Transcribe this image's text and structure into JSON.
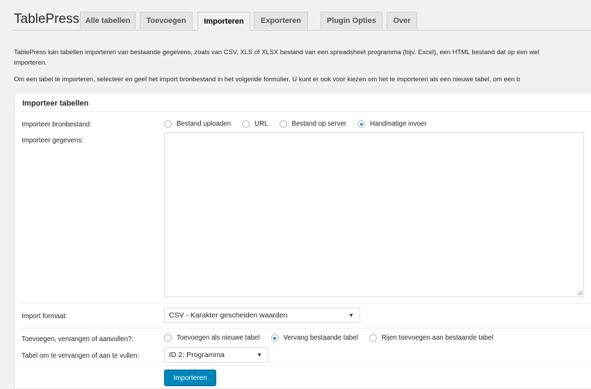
{
  "app": {
    "title": "TablePress"
  },
  "tabs": [
    {
      "label": "Alle tabellen"
    },
    {
      "label": "Toevoegen"
    },
    {
      "label": "Importeren"
    },
    {
      "label": "Exporteren"
    },
    {
      "label": "Plugin Opties"
    },
    {
      "label": "Over"
    }
  ],
  "active_tab": "Importeren",
  "intro": {
    "line1": "TablePress kan tabellen importeren van bestaande gegevens, zoals van CSV, XLS of XLSX bestand van een spreadsheet programma (bijv. Excel), een HTML bestand dat op een wel",
    "line2": "importeren.",
    "line3": "Om een tabel te importeren, selecteer en geef het import bronbestand in het volgende formulier. U kunt er ook voor kiezen om het te importeren als een nieuwe tabel, om een b"
  },
  "panel": {
    "title": "Importeer tabellen",
    "source": {
      "label": "Importeer bronbestand:",
      "options": [
        "Bestand uploaden",
        "URL",
        "Bestand op server",
        "Handmatige invoer"
      ],
      "selected": "Handmatige invoer"
    },
    "data_label": "Importeer gegevens:",
    "data_value": "",
    "format": {
      "label": "Import formaat:",
      "value": "CSV - Karakter gescheiden waarden"
    },
    "mode": {
      "label": "Toevoegen, vervangen of aanvullen?:",
      "options": [
        "Toevoegen als nieuwe tabel",
        "Vervang bestaande tabel",
        "Rijen toevoegen aan bestaande tabel"
      ],
      "selected": "Vervang bestaande tabel"
    },
    "target": {
      "label": "Tabel om te vervangen of aan te vullen:",
      "value": "ID 2: Programma"
    },
    "submit_label": "Importeren"
  },
  "colors": {
    "accent": "#0085ba",
    "radio_dot": "#1e8cbe",
    "background": "#f1f1f1"
  },
  "icons": {
    "select_arrow": "chevron-down-icon"
  }
}
